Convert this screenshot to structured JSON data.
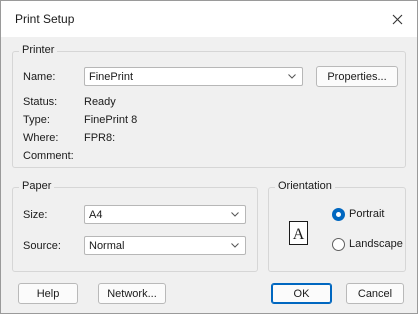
{
  "window": {
    "title": "Print Setup",
    "close_icon": "close-icon"
  },
  "printer": {
    "group_label": "Printer",
    "name_label": "Name:",
    "name_value": "FinePrint",
    "properties_label": "Properties...",
    "status_label": "Status:",
    "status_value": "Ready",
    "type_label": "Type:",
    "type_value": "FinePrint 8",
    "where_label": "Where:",
    "where_value": "FPR8:",
    "comment_label": "Comment:",
    "comment_value": ""
  },
  "paper": {
    "group_label": "Paper",
    "size_label": "Size:",
    "size_value": "A4",
    "source_label": "Source:",
    "source_value": "Normal"
  },
  "orientation": {
    "group_label": "Orientation",
    "portrait_label": "Portrait",
    "landscape_label": "Landscape",
    "selected": "Portrait",
    "preview_glyph": "A"
  },
  "buttons": {
    "help": "Help",
    "network": "Network...",
    "ok": "OK",
    "cancel": "Cancel"
  },
  "colors": {
    "accent": "#0067c0",
    "dialog_bg": "#f0f0f0"
  }
}
